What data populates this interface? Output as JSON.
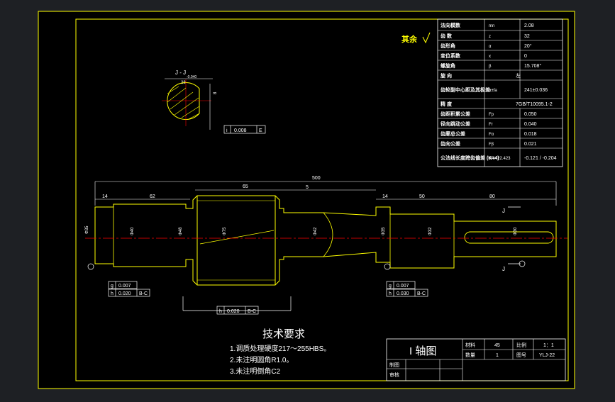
{
  "colors": {
    "background": "#1e2024",
    "sheet": "#000000",
    "border": "#ffff00",
    "dimension": "#ffffff",
    "part_outline": "#ffff00",
    "centerline": "#ff0000"
  },
  "gear_params": [
    {
      "name": "法向模数",
      "symbol": "mn",
      "value": "2.08"
    },
    {
      "name": "齿 数",
      "symbol": "z",
      "value": "32"
    },
    {
      "name": "齿形角",
      "symbol": "α",
      "value": "20°"
    },
    {
      "name": "变位系数",
      "symbol": "x",
      "value": "0"
    },
    {
      "name": "螺旋角",
      "symbol": "β",
      "value": "15.708°"
    },
    {
      "name": "旋 向",
      "symbol": "",
      "value": "左"
    },
    {
      "name": "齿轮副中心距及其极差",
      "symbol": "α±fa",
      "value": "241±0.036"
    },
    {
      "name": "精 度",
      "symbol": "",
      "value": "7GB/T10095.1-2"
    },
    {
      "name": "齿距积累公差",
      "symbol": "Fp",
      "value": "0.050"
    },
    {
      "name": "径向跳动公差",
      "symbol": "Fr",
      "value": "0.040"
    },
    {
      "name": "齿廓总公差",
      "symbol": "Fα",
      "value": "0.018"
    },
    {
      "name": "齿向公差",
      "symbol": "Fβ",
      "value": "0.021"
    },
    {
      "name": "公法线长度跨齿偏差 (K=4)",
      "symbol": "Wk=22.423",
      "value": "-0.121 / -0.204"
    }
  ],
  "surface_note": "其余",
  "section_view": {
    "title": "J - J",
    "dim_width": "28",
    "dim_width_tol": "-0.040",
    "dim_key": "8",
    "tolerance_frame": [
      "i",
      "0.008",
      "E"
    ]
  },
  "dimensions": {
    "overall": "500",
    "seg1": "14",
    "seg2": "62",
    "gear_width": "65",
    "chamfer_gap": "5",
    "seg_right1": "14",
    "seg_right2": "50",
    "seg_right3": "80",
    "dia_left": "Φ35",
    "dia_d1": "Φ40",
    "dia_d2": "Φ48",
    "dia_gear": "Φ75",
    "dia_d3": "Φ42",
    "dia_d4": "Φ35",
    "dia_d5": "Φ32",
    "dia_key": "Φ30",
    "section_label": "J"
  },
  "tol_frames": {
    "left": [
      [
        "g",
        "0.007"
      ],
      [
        "h",
        "0.020",
        "B-C"
      ]
    ],
    "bottom": [
      "h",
      "0.020",
      "B-C"
    ],
    "right": [
      [
        "g",
        "0.007"
      ],
      [
        "h",
        "0.030",
        "B-C"
      ]
    ]
  },
  "requirements": {
    "heading": "技术要求",
    "items": [
      "1.调质处理硬度217～255HBS。",
      "2.未注明圆角R1.0。",
      "3.未注明倒角C2"
    ]
  },
  "title_block": {
    "drawing_name": "I 轴图",
    "material_label": "材料",
    "material_value": "45",
    "scale_label": "比例",
    "scale_value": "1：1",
    "qty_label": "数量",
    "qty_value": "1",
    "drawing_no_label": "图号",
    "drawing_no_value": "YLJ-22",
    "drawn_label": "制图",
    "check_label": "审核"
  }
}
